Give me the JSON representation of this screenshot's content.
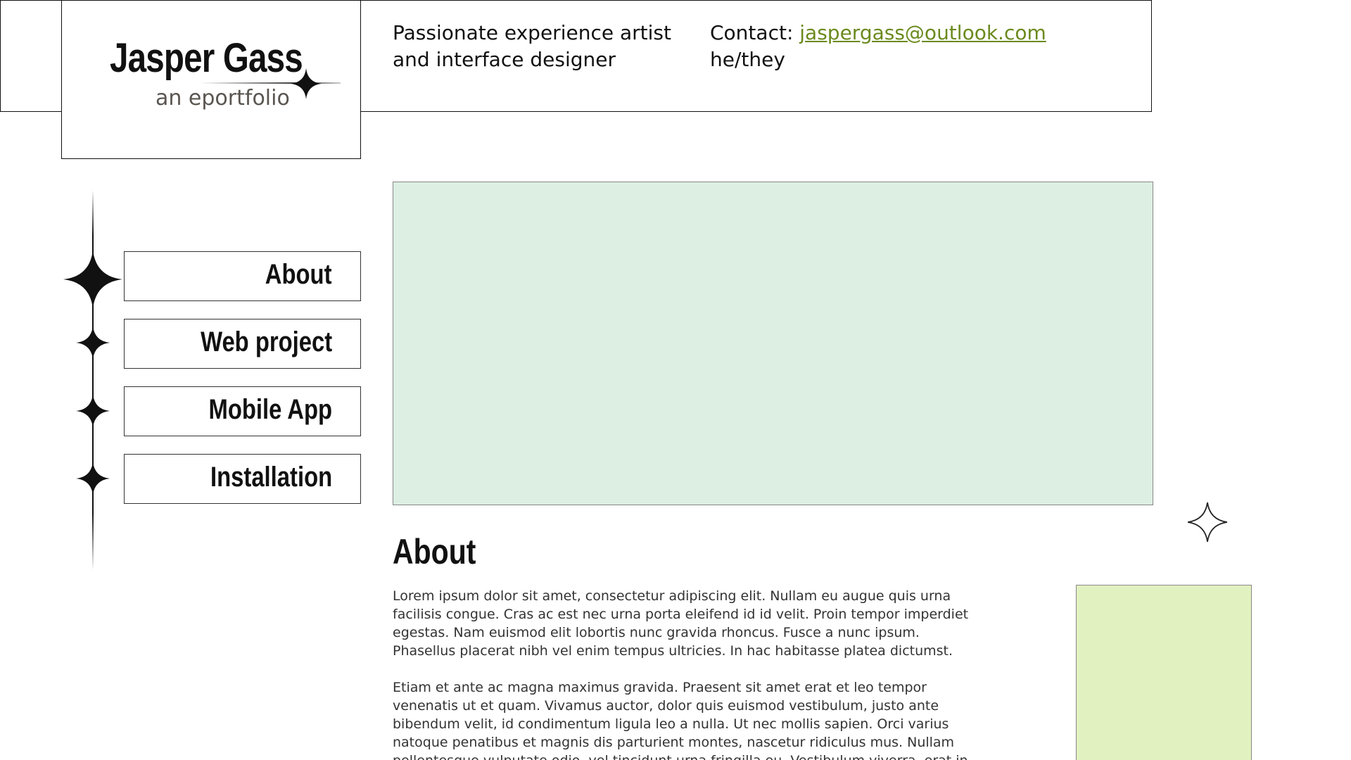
{
  "header": {
    "name": "Jasper Gass",
    "subtitle": "an eportfolio",
    "tagline": "Passionate experience artist and interface designer",
    "contact_label": "Contact: ",
    "contact_email": "jaspergass@outlook.com",
    "pronouns": "he/they"
  },
  "nav": {
    "items": [
      {
        "label": "About"
      },
      {
        "label": "Web project"
      },
      {
        "label": "Mobile App"
      },
      {
        "label": "Installation"
      }
    ]
  },
  "main": {
    "section_title": "About",
    "paragraphs": [
      "Lorem ipsum dolor sit amet, consectetur adipiscing elit. Nullam eu augue quis urna facilisis congue. Cras ac est nec urna porta eleifend id id velit. Proin tempor imperdiet egestas. Nam euismod elit lobortis nunc gravida rhoncus. Fusce a nunc ipsum. Phasellus placerat nibh vel enim tempus ultricies. In hac habitasse platea dictumst.",
      "Etiam et ante ac magna maximus gravida. Praesent sit amet erat et leo tempor venenatis ut et quam. Vivamus auctor, dolor quis euismod vestibulum, justo ante bibendum velit, id condimentum ligula leo a nulla. Ut nec mollis sapien. Orci varius natoque penatibus et magnis dis parturient montes, nascetur ridiculus mus. Nullam pellentesque vulputate odio, vel tincidunt urna fringilla eu. Vestibulum viverra, erat in"
    ]
  },
  "colors": {
    "hero_fill": "#dcefe2",
    "side_panel_fill": "#e1f1c0",
    "link": "#6b8a1e"
  },
  "icons": {
    "logo": "four-point-star-icon",
    "nav": "four-point-star-icon",
    "decor": "outline-four-point-star-icon"
  }
}
